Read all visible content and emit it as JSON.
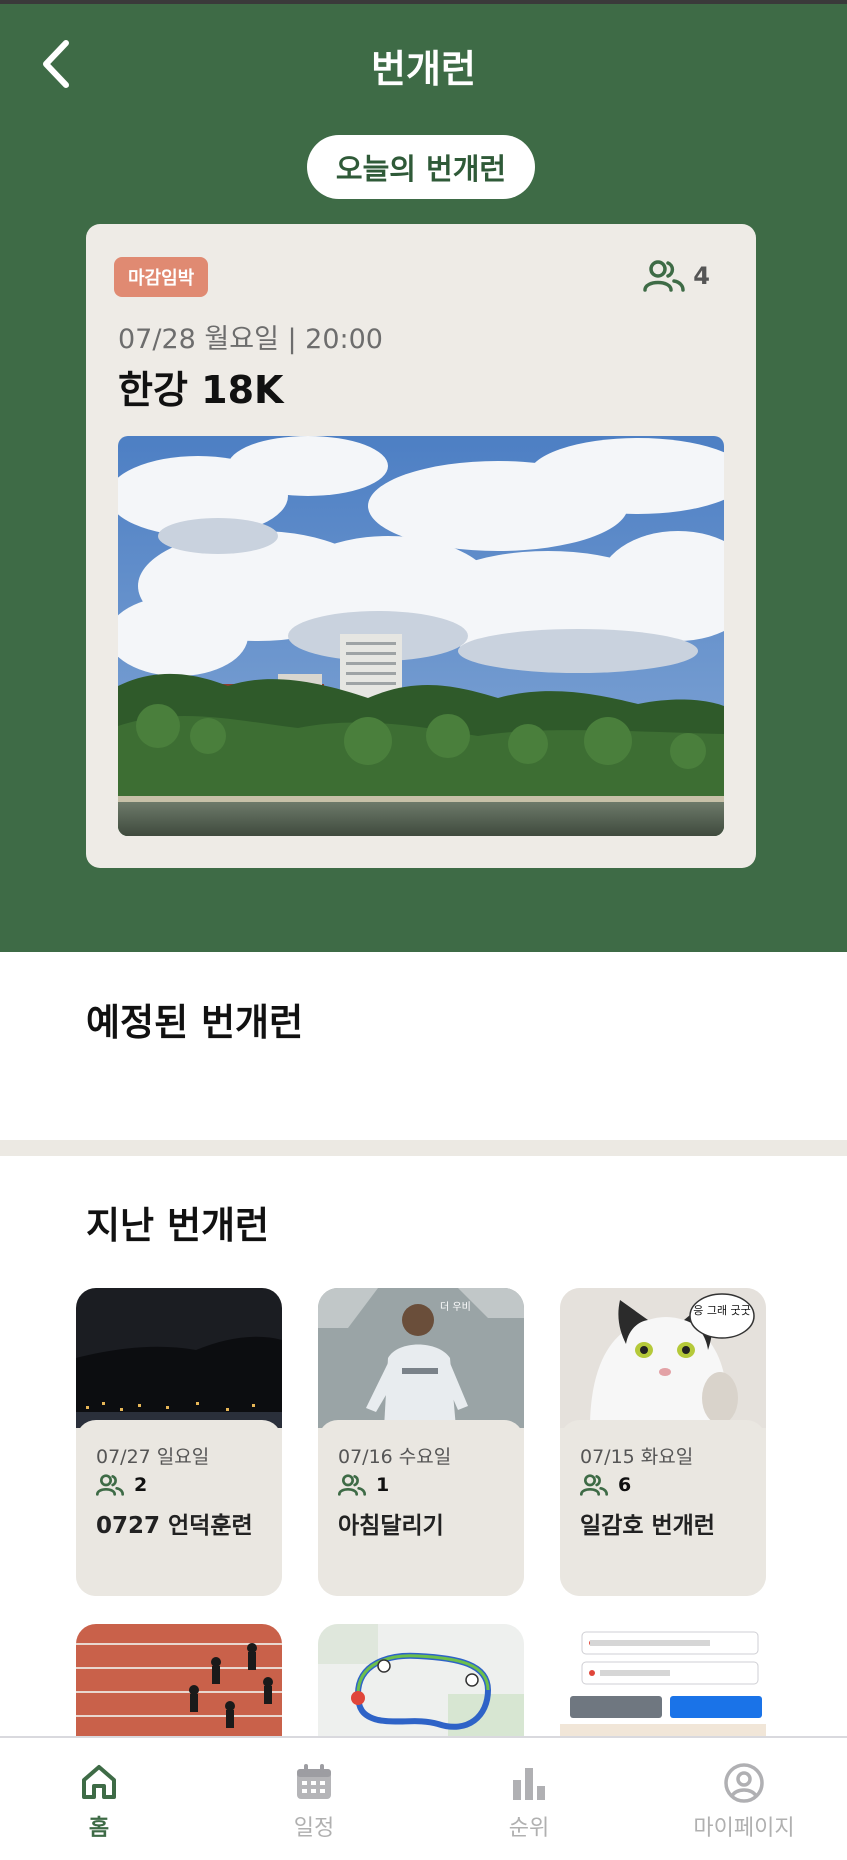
{
  "header": {
    "title": "번개런",
    "back_icon": "chevron-left-icon"
  },
  "today": {
    "pill_label": "오늘의 번개런",
    "badge": "마감임박",
    "participants": "4",
    "date": "07/28 월요일 | 20:00",
    "name": "한강 18K"
  },
  "upcoming": {
    "title": "예정된 번개런"
  },
  "past": {
    "title": "지난 번개런",
    "items": [
      {
        "date": "07/27 일요일",
        "count": "2",
        "name": "0727 언덕훈련"
      },
      {
        "date": "07/16 수요일",
        "count": "1",
        "name": "아침달리기"
      },
      {
        "date": "07/15 화요일",
        "count": "6",
        "name": "일감호 번개런"
      }
    ],
    "thumb_texts": {
      "cat_bubble": "응 그래 굿굿",
      "runner_logo": "더 우비"
    }
  },
  "nav": {
    "items": [
      {
        "label": "홈",
        "icon": "home-icon",
        "active": true
      },
      {
        "label": "일정",
        "icon": "calendar-icon",
        "active": false
      },
      {
        "label": "순위",
        "icon": "bar-chart-icon",
        "active": false
      },
      {
        "label": "마이페이지",
        "icon": "user-circle-icon",
        "active": false
      }
    ]
  },
  "colors": {
    "brand_green": "#3e6b46",
    "badge_coral": "#e08a72",
    "card_bg": "#eeebe6"
  }
}
